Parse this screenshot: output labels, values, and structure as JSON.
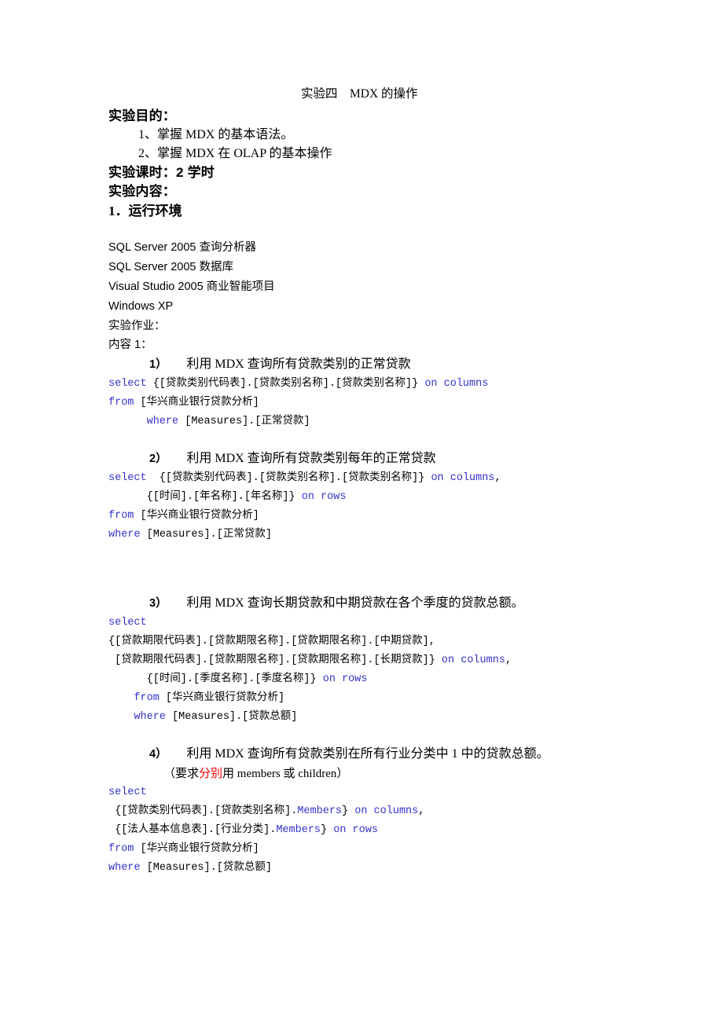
{
  "document": {
    "title": "实验四　MDX 的操作",
    "sections": {
      "purpose_heading": "实验目的：",
      "purpose_items": [
        "1、掌握 MDX 的基本语法。",
        "2、掌握 MDX 在 OLAP 的基本操作"
      ],
      "hours_heading": "实验课时：2 学时",
      "content_heading": "实验内容：",
      "env_heading": "1．运行环境",
      "env_items": [
        "SQL Server 2005  查询分析器",
        "SQL Server 2005  数据库",
        "Visual Studio 2005  商业智能项目",
        "Windows XP"
      ],
      "homework_label": "实验作业：",
      "content1_label": "内容 1："
    },
    "tasks": [
      {
        "index": "1）",
        "heading": "利用 MDX 查询所有贷款类别的正常贷款",
        "code": [
          {
            "parts": [
              {
                "t": "select",
                "c": "kw"
              },
              {
                "t": " {[贷款类别代码表].[贷款类别名称].[贷款类别名称]} ",
                "c": "id"
              },
              {
                "t": "on columns",
                "c": "kw"
              }
            ]
          },
          {
            "parts": [
              {
                "t": "from",
                "c": "kw"
              },
              {
                "t": " [华兴商业银行贷款分析]",
                "c": "id"
              }
            ]
          },
          {
            "parts": [
              {
                "t": "      where",
                "c": "kw"
              },
              {
                "t": " [Measures].[正常贷款]",
                "c": "id"
              }
            ]
          }
        ]
      },
      {
        "index": "2）",
        "heading": "利用 MDX 查询所有贷款类别每年的正常贷款",
        "code": [
          {
            "parts": [
              {
                "t": "select",
                "c": "kw"
              },
              {
                "t": "  {[贷款类别代码表].[贷款类别名称].[贷款类别名称]} ",
                "c": "id"
              },
              {
                "t": "on columns",
                "c": "kw"
              },
              {
                "t": ",",
                "c": "id"
              }
            ]
          },
          {
            "parts": [
              {
                "t": "      {[时间].[年名称].[年名称]} ",
                "c": "id"
              },
              {
                "t": "on rows",
                "c": "kw"
              }
            ]
          },
          {
            "parts": [
              {
                "t": "from",
                "c": "kw"
              },
              {
                "t": " [华兴商业银行贷款分析]",
                "c": "id"
              }
            ]
          },
          {
            "parts": [
              {
                "t": "where",
                "c": "kw"
              },
              {
                "t": " [Measures].[正常贷款]",
                "c": "id"
              }
            ]
          }
        ]
      },
      {
        "index": "3）",
        "heading": "利用 MDX 查询长期贷款和中期贷款在各个季度的贷款总额。",
        "code": [
          {
            "parts": [
              {
                "t": "select",
                "c": "kw"
              }
            ]
          },
          {
            "parts": [
              {
                "t": "{[贷款期限代码表].[贷款期限名称].[贷款期限名称].[中期贷款],",
                "c": "id"
              }
            ]
          },
          {
            "parts": [
              {
                "t": " [贷款期限代码表].[贷款期限名称].[贷款期限名称].[长期贷款]} ",
                "c": "id"
              },
              {
                "t": "on columns",
                "c": "kw"
              },
              {
                "t": ",",
                "c": "id"
              }
            ]
          },
          {
            "parts": [
              {
                "t": "      {[时间].[季度名称].[季度名称]} ",
                "c": "id"
              },
              {
                "t": "on rows",
                "c": "kw"
              }
            ]
          },
          {
            "parts": [
              {
                "t": "    from",
                "c": "kw"
              },
              {
                "t": " [华兴商业银行贷款分析]",
                "c": "id"
              }
            ]
          },
          {
            "parts": [
              {
                "t": "    where",
                "c": "kw"
              },
              {
                "t": " [Measures].[贷款总额]",
                "c": "id"
              }
            ]
          }
        ]
      },
      {
        "index": "4）",
        "heading": "利用 MDX 查询所有贷款类别在所有行业分类中 1 中的贷款总额。",
        "note_prefix": "（要求",
        "note_red": "分别",
        "note_suffix": "用 members 或 children）",
        "code": [
          {
            "parts": [
              {
                "t": "select",
                "c": "kw"
              }
            ]
          },
          {
            "parts": [
              {
                "t": " {[贷款类别代码表].[贷款类别名称].",
                "c": "id"
              },
              {
                "t": "Members",
                "c": "kw"
              },
              {
                "t": "} ",
                "c": "id"
              },
              {
                "t": "on columns",
                "c": "kw"
              },
              {
                "t": ",",
                "c": "id"
              }
            ]
          },
          {
            "parts": [
              {
                "t": " {[法人基本信息表].[行业分类].",
                "c": "id"
              },
              {
                "t": "Members",
                "c": "kw"
              },
              {
                "t": "} ",
                "c": "id"
              },
              {
                "t": "on rows",
                "c": "kw"
              }
            ]
          },
          {
            "parts": [
              {
                "t": "from",
                "c": "kw"
              },
              {
                "t": " [华兴商业银行贷款分析]",
                "c": "id"
              }
            ]
          },
          {
            "parts": [
              {
                "t": "where",
                "c": "kw"
              },
              {
                "t": " [Measures].[贷款总额]",
                "c": "id"
              }
            ]
          }
        ]
      }
    ]
  },
  "colors": {
    "keyword": "#3333cc",
    "identifier": "#000000",
    "highlight": "#ff0000",
    "background": "#ffffff"
  }
}
